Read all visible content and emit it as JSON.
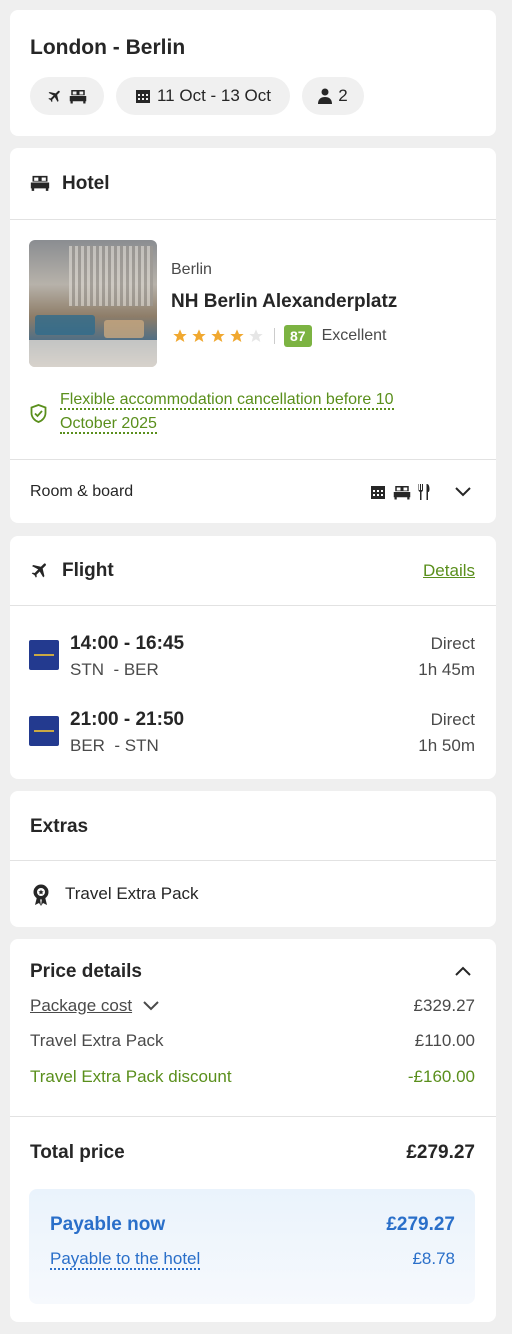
{
  "trip": {
    "title": "London - Berlin",
    "dates": "11 Oct - 13 Oct",
    "travellers": "2"
  },
  "hotel": {
    "section_title": "Hotel",
    "city": "Berlin",
    "name": "NH Berlin Alexanderplatz",
    "stars": 4,
    "max_stars": 5,
    "score": "87",
    "score_label": "Excellent",
    "cancellation": "Flexible accommodation cancellation before 10 October 2025",
    "room_board_label": "Room & board"
  },
  "flight": {
    "section_title": "Flight",
    "details_link": "Details",
    "legs": [
      {
        "times": "14:00 - 16:45",
        "route": "STN  - BER",
        "type": "Direct",
        "duration": "1h 45m"
      },
      {
        "times": "21:00 - 21:50",
        "route": "BER  - STN",
        "type": "Direct",
        "duration": "1h 50m"
      }
    ]
  },
  "extras": {
    "section_title": "Extras",
    "item": "Travel Extra Pack"
  },
  "price": {
    "section_title": "Price details",
    "package_cost_label": "Package cost",
    "package_cost": "£329.27",
    "extra_pack_label": "Travel Extra Pack",
    "extra_pack": "£110.00",
    "discount_label": "Travel Extra Pack discount",
    "discount": "-£160.00",
    "total_label": "Total price",
    "total": "£279.27",
    "payable_now_label": "Payable now",
    "payable_now": "£279.27",
    "payable_hotel_label": "Payable to the hotel",
    "payable_hotel": "£8.78"
  },
  "colors": {
    "accent_green": "#5a8f1c",
    "accent_blue": "#2a6fc9",
    "star": "#f0a830",
    "score_badge": "#7cb342"
  }
}
